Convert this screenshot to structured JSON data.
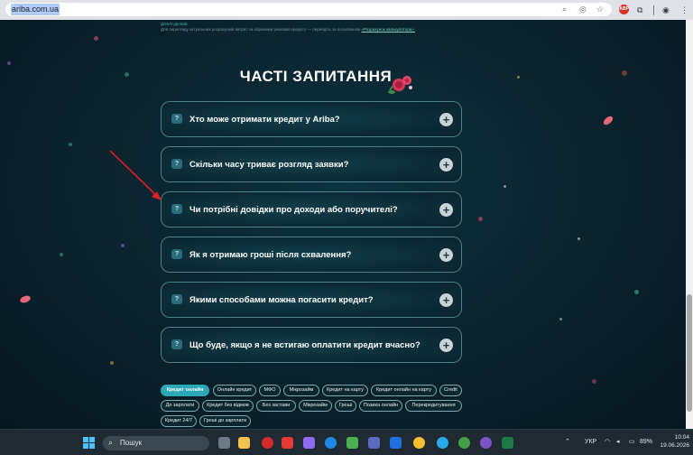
{
  "browser": {
    "url": "ariba.com.ua"
  },
  "disclaimer": {
    "line1": "ДОКЛАДНІШЕ",
    "line2": "Для перегляду актуальних розрахунків витрат за обраними умовами кредиту — перейдіть за посиланням",
    "link": "«Розрахунок калькулятора»."
  },
  "faq": {
    "title": "ЧАСТІ ЗАПИТАННЯ",
    "questions": [
      "Хто може отримати кредит у Ariba?",
      "Скільки часу триває розгляд заявки?",
      "Чи потрібні довідки про доходи або поручителі?",
      "Як я отримаю гроші після схвалення?",
      "Якими способами можна погасити кредит?",
      "Що буде, якщо я не встигаю оплатити кредит вчасно?"
    ]
  },
  "tags": [
    "Кредит онлайн",
    "Онлайн кредит",
    "МФО",
    "Мікрозайм",
    "Кредит на карту",
    "Кредит онлайн на карту",
    "Credit",
    "До зарплати",
    "Кредит без відмов",
    "Без застави",
    "Мікрозайм",
    "Гроші",
    "Позика онлайн",
    "Перекредитування",
    "Кредит 24/7",
    "Гроші до зарплати"
  ],
  "taskbar": {
    "search": "Пошук",
    "lang": "УКР",
    "battery": "89%",
    "time": "10:04",
    "date": "19.06.2026"
  },
  "colors": {
    "background": "#0a1e28",
    "accent": "#2aa8b5",
    "annotation": "#e02020"
  }
}
